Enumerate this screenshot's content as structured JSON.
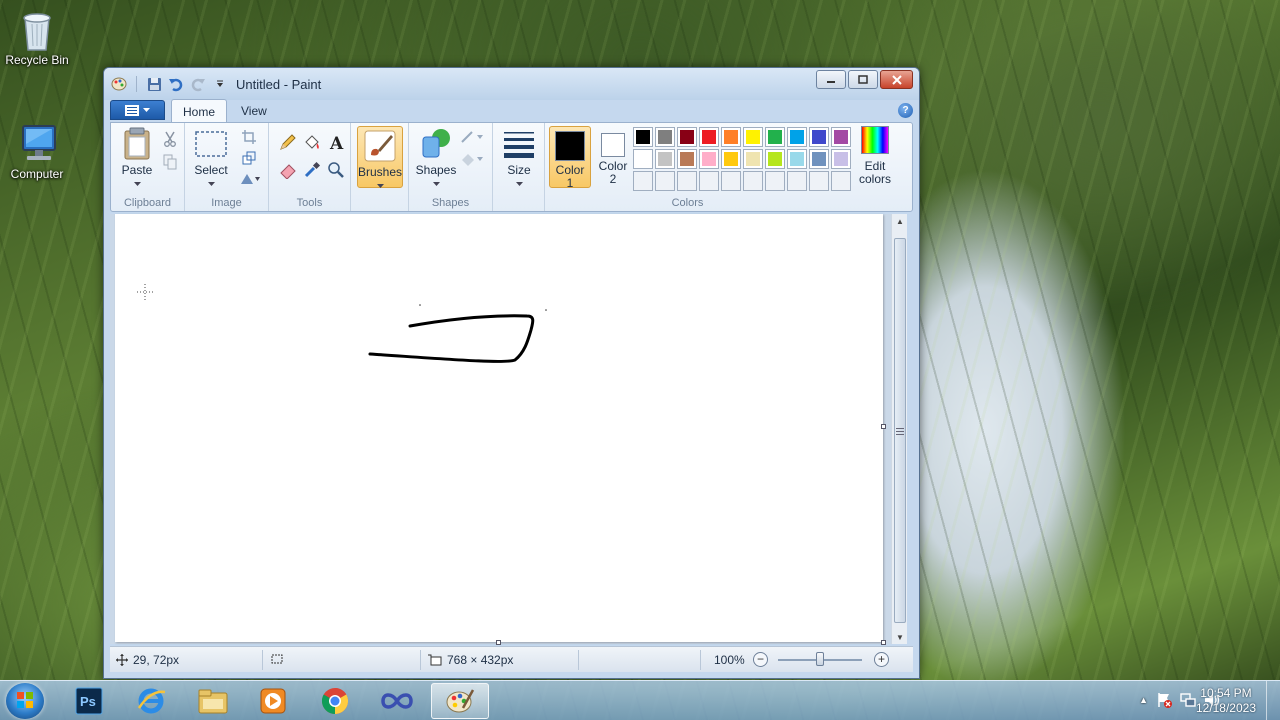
{
  "desktop": {
    "icons": [
      {
        "label": "Recycle Bin",
        "icon": "recycle-bin-icon"
      },
      {
        "label": "Computer",
        "icon": "computer-icon"
      }
    ]
  },
  "window": {
    "title": "Untitled - Paint",
    "tabs": [
      "Home",
      "View"
    ],
    "active_tab": "Home"
  },
  "ribbon": {
    "groups": {
      "clipboard": {
        "label": "Clipboard",
        "paste": "Paste"
      },
      "image": {
        "label": "Image",
        "select": "Select"
      },
      "tools": {
        "label": "Tools"
      },
      "brushes": {
        "label": "Brushes"
      },
      "shapes": {
        "label": "Shapes",
        "shapes_btn": "Shapes"
      },
      "size": {
        "label": "Size"
      },
      "colors": {
        "label": "Colors",
        "color1_line1": "Color",
        "color1_line2": "1",
        "color2_line1": "Color",
        "color2_line2": "2",
        "edit_line1": "Edit",
        "edit_line2": "colors",
        "color1_value": "#000000",
        "color2_value": "#ffffff",
        "palette_row1": [
          "#000000",
          "#7f7f7f",
          "#880015",
          "#ed1c24",
          "#ff7f27",
          "#fff200",
          "#22b14c",
          "#00a2e8",
          "#3f48cc",
          "#a349a4"
        ],
        "palette_row2": [
          "#ffffff",
          "#c3c3c3",
          "#b97a57",
          "#ffaec9",
          "#ffc90e",
          "#efe4b0",
          "#b5e61d",
          "#99d9ea",
          "#7092be",
          "#c8bfe7"
        ]
      }
    }
  },
  "statusbar": {
    "cursor_pos": "29, 72px",
    "canvas_size": "768 × 432px",
    "zoom": "100%",
    "zoom_out": "−",
    "zoom_in": "+"
  },
  "taskbar": {
    "apps": [
      "photoshop-icon",
      "internet-explorer-icon",
      "file-explorer-icon",
      "media-player-icon",
      "chrome-icon",
      "infinity-app-icon",
      "paint-icon"
    ],
    "active_app": "paint-icon",
    "time": "10:54 PM",
    "date": "12/18/2023",
    "tray_expand": "▲"
  }
}
